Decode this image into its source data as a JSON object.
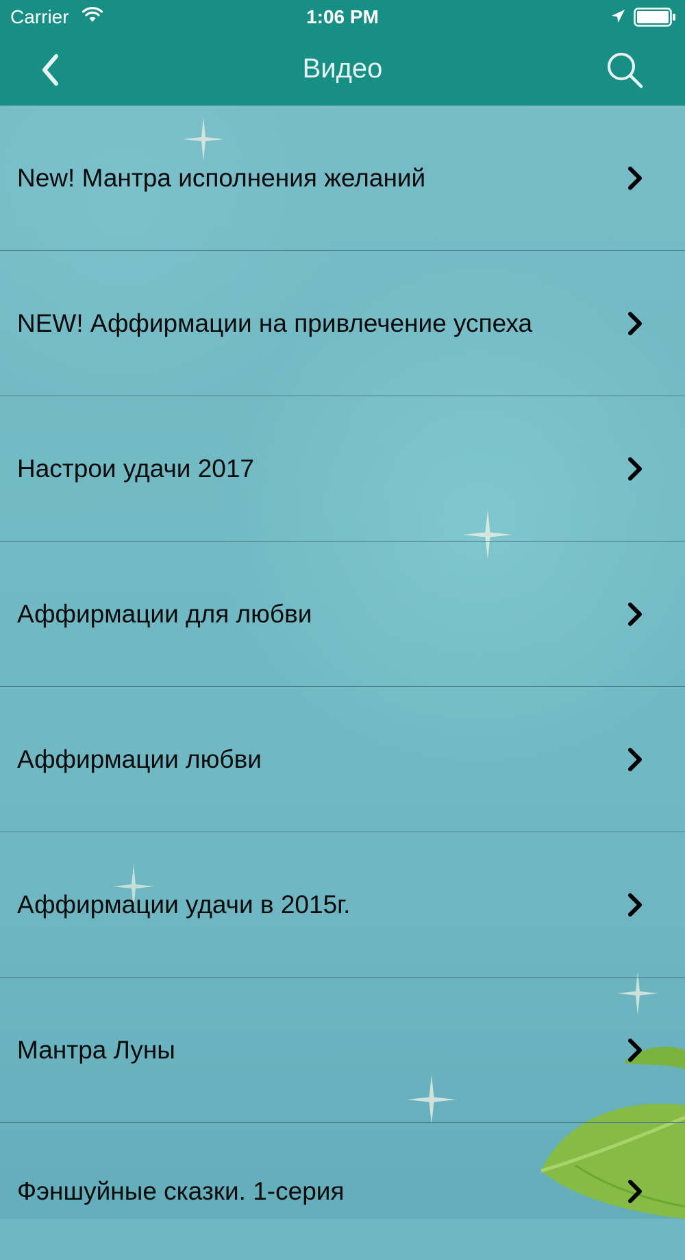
{
  "status_bar": {
    "carrier": "Carrier",
    "time": "1:06 PM"
  },
  "nav": {
    "title": "Видео",
    "back_icon": "chevron-left-icon",
    "search_icon": "search-icon"
  },
  "list": {
    "items": [
      {
        "label": "New! Мантра исполнения желаний"
      },
      {
        "label": "NEW! Аффирмации на привлечение успеха"
      },
      {
        "label": "Настрои удачи 2017"
      },
      {
        "label": "Аффирмации для любви"
      },
      {
        "label": "Аффирмации любви"
      },
      {
        "label": "Аффирмации удачи в 2015г."
      },
      {
        "label": "Мантра Луны"
      },
      {
        "label": "Фэншуйные сказки. 1-серия"
      }
    ]
  },
  "colors": {
    "nav_background": "#188f85",
    "list_background": "#6fb8c3",
    "separator": "#4d7f88",
    "text": "#0b0b0b"
  }
}
